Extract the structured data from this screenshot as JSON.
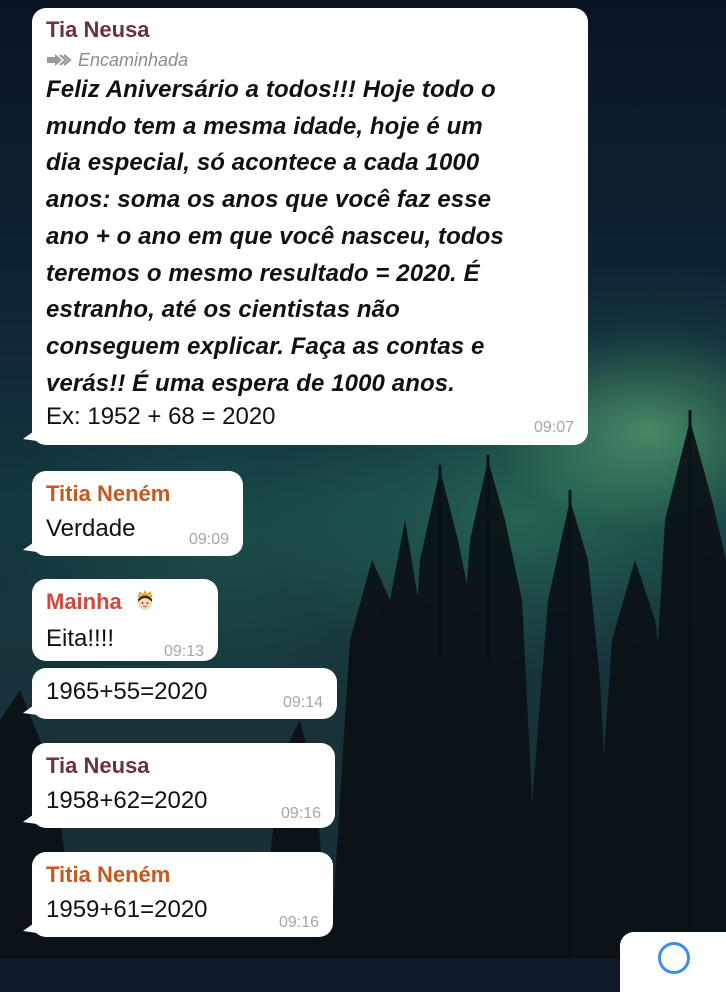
{
  "messages": [
    {
      "sender": "Tia Neusa",
      "sender_color": "#6a2f4a",
      "forwarded_label": "Encaminhada",
      "forwarded_icon": "forward-arrow-icon",
      "text_lines": [
        "Feliz Aniversário a todos!!! Hoje todo o",
        "mundo tem a mesma idade, hoje é um",
        "dia especial, só acontece a cada 1000",
        "anos: soma os anos que você faz esse",
        "ano + o ano em que você nasceu, todos",
        "teremos o mesmo resultado = 2020. É",
        "estranho, até os cientistas não",
        "conseguem explicar. Faça as contas e",
        "verás!! É uma espera de 1000 anos."
      ],
      "example": "Ex: 1952 + 68 = 2020",
      "time": "09:07"
    },
    {
      "sender": "Titia Neném",
      "sender_color": "#c25a1f",
      "text": "Verdade",
      "time": "09:09"
    },
    {
      "sender": "Mainha",
      "sender_color": "#d2483a",
      "sender_emoji_icon": "princess-emoji-icon",
      "text": "Eita!!!!",
      "time": "09:13"
    },
    {
      "text": "1965+55=2020",
      "time": "09:14"
    },
    {
      "sender": "Tia Neusa",
      "sender_color": "#6a2f4a",
      "text": "1958+62=2020",
      "time": "09:16"
    },
    {
      "sender": "Titia Neném",
      "sender_color": "#c25a1f",
      "text": "1959+61=2020",
      "time": "09:16"
    }
  ],
  "corner_button_icon": "scroll-down-icon"
}
